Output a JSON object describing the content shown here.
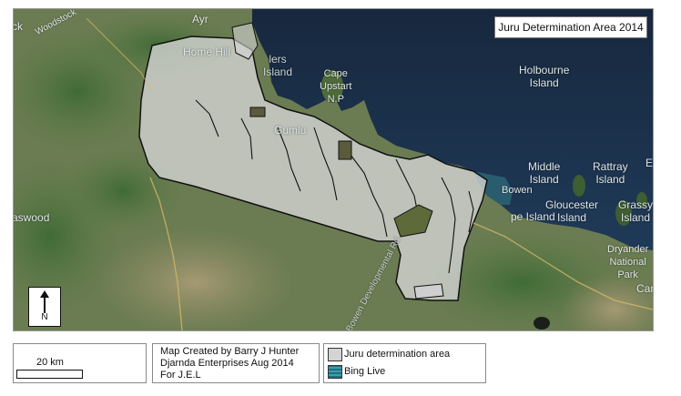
{
  "map": {
    "title": "Juru Determination Area 2014",
    "places": {
      "ayr": "Ayr",
      "woodstock": "Woodstock",
      "ck": "ck",
      "home_hill": "Home Hill",
      "lers_island": "lers\nIsland",
      "cape_upstart": "Cape\nUpstart\nN.P",
      "gumlu": "Gumlu",
      "holbourne_island": "Holbourne\nIsland",
      "middle_island": "Middle\nIsland",
      "rattray_island": "Rattray\nIsland",
      "gloucester_island": "Gloucester\nIsland",
      "grassy_island": "Grassy\nIsland",
      "bowen": "Bowen",
      "hope_island": "pe Island",
      "dryander_np": "Dryander\nNational\nPark",
      "cannonvale": "Can",
      "e_partial": "E",
      "aswood": "aswood",
      "road": "Bowen Developmental Rd"
    },
    "north_arrow": "N"
  },
  "legend": {
    "scale_label": "20 km",
    "credit": [
      "Map Created by Barry J Hunter",
      "Djarnda Enterprises Aug 2014",
      "For J.E.L"
    ],
    "items": [
      {
        "label": "Juru determination area",
        "color": "#d4d4d4"
      },
      {
        "label": "Bing Live",
        "color": "#2c8a9a"
      }
    ]
  }
}
